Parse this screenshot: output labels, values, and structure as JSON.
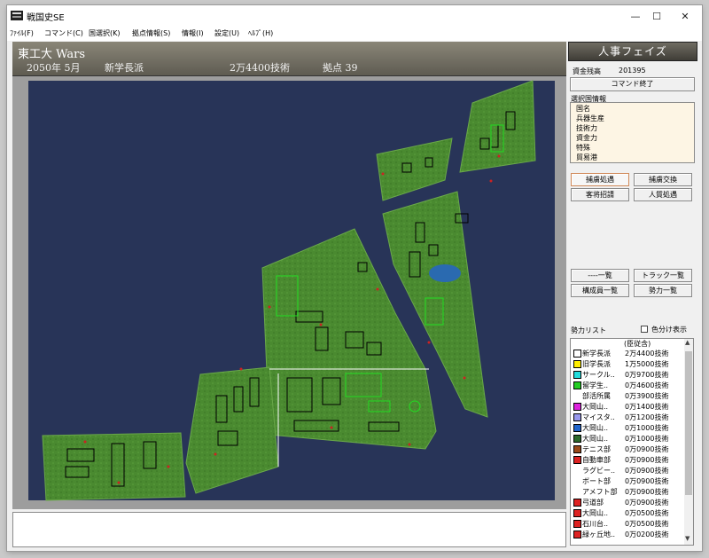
{
  "window": {
    "title": "戦国史SE",
    "min": "—",
    "max": "☐",
    "close": "✕"
  },
  "menu": [
    "ﾌｧｲﾙ(F)",
    "コマンド(C)",
    "国選択(K)",
    "拠点情報(S)",
    "情報(I)",
    "設定(U)",
    "ﾍﾙﾌﾟ(H)"
  ],
  "header": {
    "scenario": "東工大 Wars",
    "date": "2050年 5月",
    "faction": "新学長派",
    "tech": "2万4400技術",
    "bases": "拠点 39"
  },
  "panel": {
    "phase": "人事フェイズ",
    "funds_label": "資金残高",
    "funds_value": "201395",
    "end_command": "コマンド終了",
    "selected_info_label": "選択国情報",
    "info_lines": [
      "国名",
      "兵器生産",
      "技術力",
      "資金力",
      "特殊",
      "貿易港"
    ],
    "buttons": [
      "捕虜処遇",
      "捕虜交換",
      "客将招請",
      "人質処遇",
      "----一覧",
      "トラック一覧",
      "構成員一覧",
      "勢力一覧"
    ],
    "faction_list_label": "勢力リスト",
    "color_toggle_label": "色分け表示",
    "list_header": "(臣従含)",
    "factions": [
      {
        "name": "新学長派",
        "value": "2万4400技術",
        "color": "#ffffff"
      },
      {
        "name": "旧学長派",
        "value": "1万5000技術",
        "color": "#ffee00"
      },
      {
        "name": "サークル..",
        "value": "0万9700技術",
        "color": "#22dddd"
      },
      {
        "name": "留学生..",
        "value": "0万4600技術",
        "color": "#22cc22"
      },
      {
        "name": "部活所属",
        "value": "0万3900技術",
        "color": ""
      },
      {
        "name": "大岡山..",
        "value": "0万1400技術",
        "color": "#dd22dd"
      },
      {
        "name": "マイスタ..",
        "value": "0万1200技術",
        "color": "#9999ee"
      },
      {
        "name": "大岡山..",
        "value": "0万1000技術",
        "color": "#2266cc"
      },
      {
        "name": "大岡山..",
        "value": "0万1000技術",
        "color": "#2c6a2c"
      },
      {
        "name": "テニス部",
        "value": "0万0900技術",
        "color": "#9a4a1a"
      },
      {
        "name": "自動車部",
        "value": "0万0900技術",
        "color": "#dd2222"
      },
      {
        "name": "ラグビー..",
        "value": "0万0900技術",
        "color": ""
      },
      {
        "name": "ボート部",
        "value": "0万0900技術",
        "color": ""
      },
      {
        "name": "アメフト部",
        "value": "0万0900技術",
        "color": ""
      },
      {
        "name": "弓道部",
        "value": "0万0900技術",
        "color": "#dd2222"
      },
      {
        "name": "大岡山..",
        "value": "0万0500技術",
        "color": "#dd2222"
      },
      {
        "name": "石川台..",
        "value": "0万0500技術",
        "color": "#dd2222"
      },
      {
        "name": "緑ヶ丘地..",
        "value": "0万0200技術",
        "color": "#dd2222"
      }
    ]
  },
  "colors": {
    "map_sea": "#283458",
    "map_land": "#4a8a30",
    "building": "#000000",
    "accent": "#d08a5a"
  }
}
